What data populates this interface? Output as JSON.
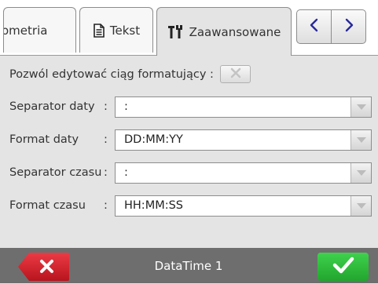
{
  "tabs": [
    {
      "label": "ometria",
      "icon": "",
      "active": false
    },
    {
      "label": "Tekst",
      "icon": "document-icon",
      "active": false
    },
    {
      "label": "Zaawansowane",
      "icon": "tools-icon",
      "active": true
    }
  ],
  "nav": {
    "prev_icon": "chevron-left-icon",
    "next_icon": "chevron-right-icon"
  },
  "form": {
    "allow_edit": {
      "label": "Pozwól edytować ciąg formatujący :",
      "checked": false,
      "icon": "close-icon"
    },
    "date_separator": {
      "label": "Separator daty",
      "colon": ":",
      "value": ":"
    },
    "date_format": {
      "label": "Format daty",
      "colon": ":",
      "value": "DD:MM:YY"
    },
    "time_separator": {
      "label": "Separator czasu",
      "colon": ":",
      "value": ":"
    },
    "time_format": {
      "label": "Format czasu",
      "colon": ":",
      "value": "HH:MM:SS"
    }
  },
  "footer": {
    "title": "DataTime 1",
    "cancel_icon": "close-icon",
    "ok_icon": "checkmark-icon"
  },
  "colors": {
    "cancel": "#d4202b",
    "ok": "#2cba39",
    "footer": "#6e6e6e"
  }
}
